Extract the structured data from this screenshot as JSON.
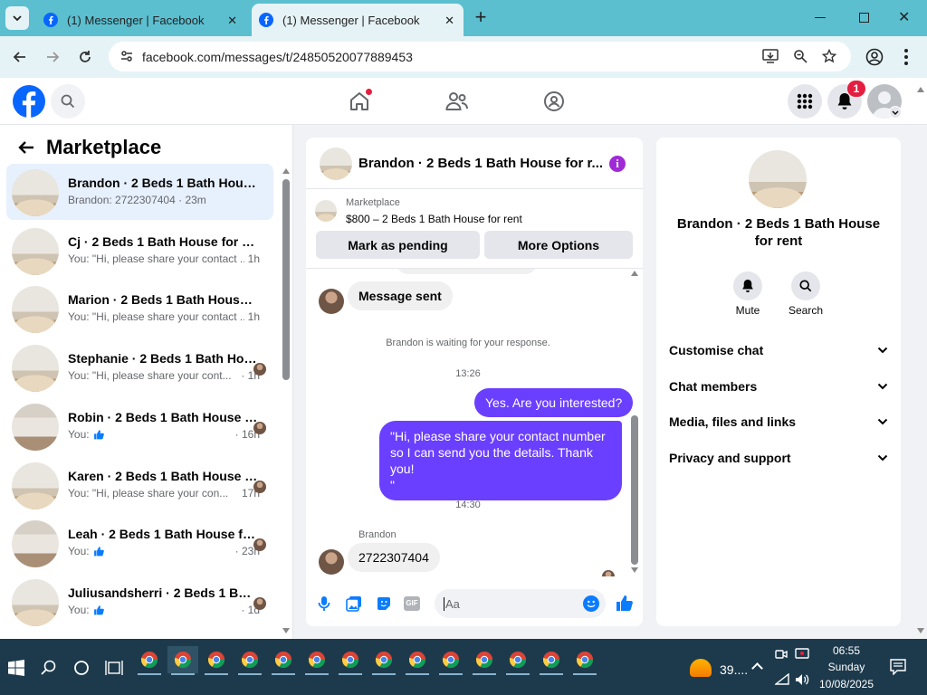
{
  "browser": {
    "tabs": [
      {
        "title": "(1) Messenger | Facebook"
      },
      {
        "title": "(1) Messenger | Facebook"
      }
    ],
    "url": "facebook.com/messages/t/24850520077889453"
  },
  "facebook": {
    "notification_count": "1"
  },
  "sidebar": {
    "title": "Marketplace",
    "conversations": [
      {
        "name": "Brandon · 2 Beds 1 Bath House f...",
        "preview": "Brandon: 2722307404 · 23m",
        "time": "",
        "photo": "bedroom",
        "selected": true
      },
      {
        "name": "Cj · 2 Beds 1 Bath House for rent",
        "preview": "You: \"Hi, please share your contact ...",
        "time": "1h",
        "photo": "bedroom"
      },
      {
        "name": "Marion · 2 Beds 1 Bath House fo...",
        "preview": "You: \"Hi, please share your contact ...",
        "time": "1h",
        "photo": "bedroom"
      },
      {
        "name": "Stephanie · 2 Beds 1 Bath Hou...",
        "preview": "You: \"Hi, please share your cont...",
        "time": "· 1h",
        "photo": "bedroom"
      },
      {
        "name": "Robin · 2 Beds 1 Bath House f...",
        "preview": "You:",
        "time": "· 16h",
        "photo": "room",
        "like": true
      },
      {
        "name": "Karen · 2 Beds 1 Bath House f...",
        "preview": "You: \"Hi, please share your con...",
        "time": "17h",
        "photo": "bedroom"
      },
      {
        "name": "Leah · 2 Beds 1 Bath House fo...",
        "preview": "You:",
        "time": "· 23h",
        "photo": "room",
        "like": true
      },
      {
        "name": "Juliusandsherri · 2 Beds 1 Bat...",
        "preview": "You:",
        "time": "· 1d",
        "photo": "bedroom",
        "like": true
      }
    ]
  },
  "chat": {
    "title": "Brandon · 2 Beds 1 Bath House for r...",
    "listing_label": "Marketplace",
    "listing_text": "$800 – 2 Beds 1 Bath House for rent",
    "mark_pending": "Mark as pending",
    "more_options": "More Options",
    "msg_sent": "Message sent",
    "waiting": "Brandon is waiting for your response.",
    "time1": "13:26",
    "out1": "Yes. Are you interested?",
    "out2": "\"Hi, please share your contact number so I can send you the details. Thank you!\n\"",
    "time2": "14:30",
    "sender": "Brandon",
    "in1": "2722307404",
    "input_placeholder": "Aa"
  },
  "details": {
    "title": "Brandon · 2 Beds 1 Bath House for rent",
    "mute": "Mute",
    "search": "Search",
    "sections": [
      "Customise chat",
      "Chat members",
      "Media, files and links",
      "Privacy and support"
    ]
  },
  "taskbar": {
    "weather": "39....",
    "time": "06:55",
    "day": "Sunday",
    "date": "10/08/2025"
  },
  "colors": {
    "accent_purple": "#6b3fff",
    "facebook_blue": "#0866ff",
    "messenger_blue": "#0a7cff"
  }
}
